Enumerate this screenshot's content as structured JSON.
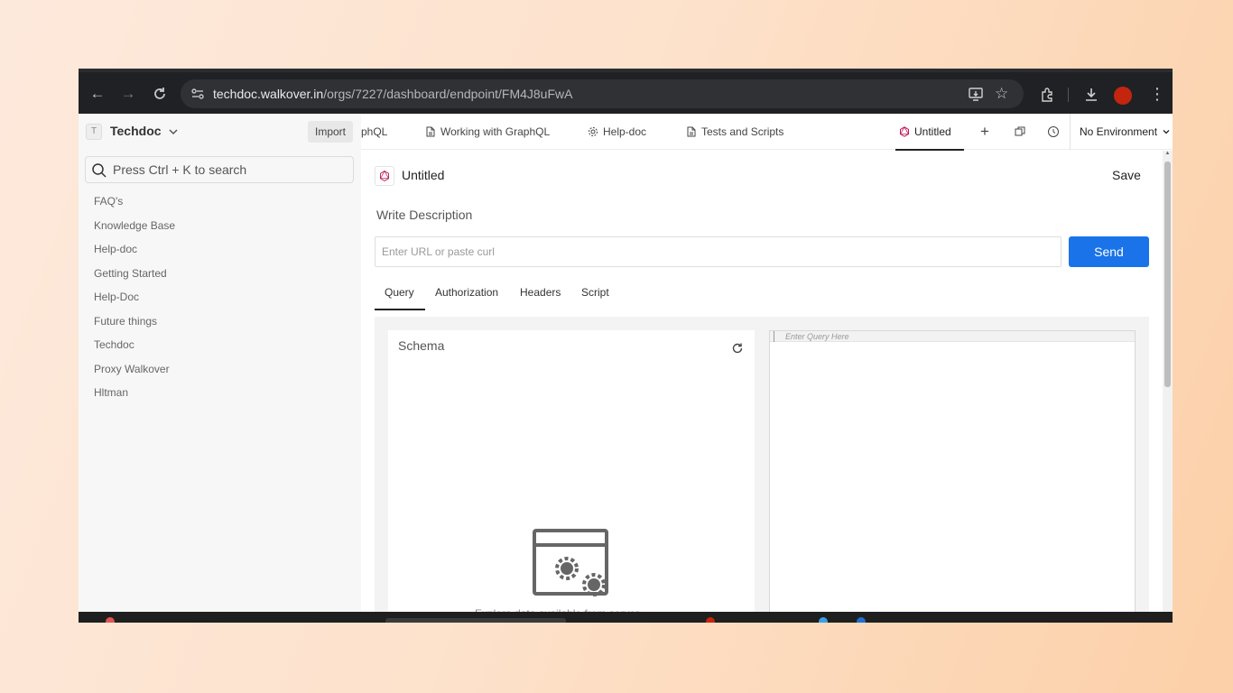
{
  "browser": {
    "url_host": "techdoc.walkover.in",
    "url_path": "/orgs/7227/dashboard/endpoint/FM4J8uFwA"
  },
  "sidebar": {
    "org_initial": "T",
    "org_name": "Techdoc",
    "import_label": "Import",
    "search_placeholder": "Press Ctrl + K to search",
    "items": [
      {
        "label": "FAQ's"
      },
      {
        "label": "Knowledge Base"
      },
      {
        "label": "Help-doc"
      },
      {
        "label": "Getting Started"
      },
      {
        "label": "Help-Doc"
      },
      {
        "label": "Future things"
      },
      {
        "label": "Techdoc"
      },
      {
        "label": "Proxy Walkover"
      },
      {
        "label": "Hltman"
      }
    ]
  },
  "tabs": [
    {
      "label": "phQL",
      "icon": "graphql-icon"
    },
    {
      "label": "Working with GraphQL",
      "icon": "page-icon"
    },
    {
      "label": "Help-doc",
      "icon": "gear-icon"
    },
    {
      "label": "Tests and Scripts",
      "icon": "page-icon"
    },
    {
      "label": "Untitled",
      "icon": "graphql-icon",
      "active": true
    }
  ],
  "environment": {
    "selected": "No Environment"
  },
  "endpoint": {
    "title": "Untitled",
    "save_label": "Save",
    "description_placeholder": "Write Description",
    "url_placeholder": "Enter URL or paste curl",
    "send_label": "Send"
  },
  "subtabs": [
    {
      "label": "Query",
      "active": true
    },
    {
      "label": "Authorization"
    },
    {
      "label": "Headers"
    },
    {
      "label": "Script"
    }
  ],
  "schema": {
    "title": "Schema",
    "hint": "Explore data available from server"
  },
  "query": {
    "placeholder": "Enter Query Here"
  },
  "colors": {
    "accent": "#1a73e8",
    "graphql": "#c2185b"
  }
}
